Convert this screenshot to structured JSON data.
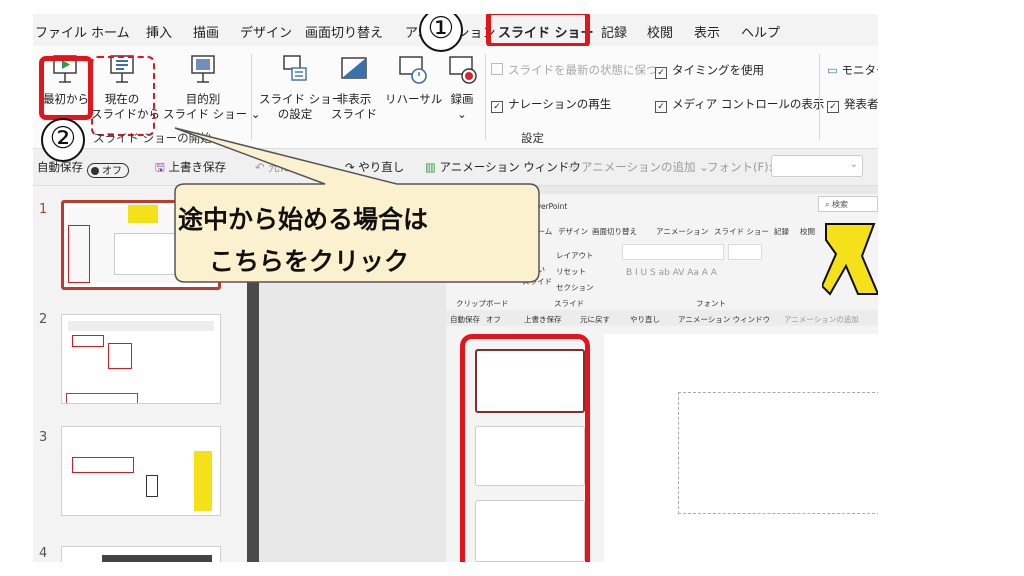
{
  "menu": {
    "items": [
      "ファイル",
      "ホーム",
      "挿入",
      "描画",
      "デザイン",
      "画面切り替え",
      "アニメーション",
      "スライド ショー",
      "記録",
      "校閲",
      "表示",
      "ヘルプ"
    ],
    "active": "スライド ショー"
  },
  "badges": {
    "one": "①",
    "two": "②"
  },
  "ribbon": {
    "from_beginning_label": "最初から",
    "from_current_line1": "現在の",
    "from_current_line2": "スライドから",
    "custom_show_line1": "目的別",
    "custom_show_line2": "スライド ショー ⌄",
    "setup_show_line1": "スライド ショー",
    "setup_show_line2": "の設定",
    "hide_slide_line1": "非表示",
    "hide_slide_line2": "スライド",
    "rehearse_label": "リハーサル",
    "record_line1": "録画",
    "record_line2": "⌄",
    "keep_updated_label": "スライドを最新の状態に保つ",
    "use_timings_label": "タイミングを使用",
    "play_narration_label": "ナレーションの再生",
    "show_media_controls_label": "メディア コントロールの表示",
    "monitor_label": "モニター:",
    "presenter_label": "発表者",
    "group_start_label": "スライド ショーの開始",
    "group_setup_label": "設定"
  },
  "qat": {
    "autosave_label": "自動保存",
    "autosave_state": "オフ",
    "save_label": "上書き保存",
    "undo_label": "元に戻す",
    "redo_label": "やり直し",
    "animation_window_label": "アニメーション ウィンドウ",
    "add_animation_label": "アニメーションの追加",
    "font_label": "フォント(F):"
  },
  "callout": {
    "line1": "途中から始める場合は",
    "line2": "こちらをクリック"
  },
  "thumbnails": [
    {
      "number": "1",
      "selected": true
    },
    {
      "number": "2",
      "selected": false
    },
    {
      "number": "3",
      "selected": false
    },
    {
      "number": "4",
      "selected": false
    }
  ],
  "inner": {
    "app_title": "PowerPoint",
    "search_label": "検索",
    "tabs": [
      "ホーム",
      "デザイン",
      "画面切り替え",
      "アニメーション",
      "スライド ショー",
      "記録",
      "校閲"
    ],
    "layout_label": "レイアウト",
    "reset_label": "リセット",
    "section_label": "セクション",
    "new_slide_label": "しい",
    "new_slide_label2": "スライド",
    "clipboard_label": "クリップボード",
    "slide_group_label": "スライド",
    "font_group_label": "フォント",
    "autosave_label": "自動保存",
    "autosave_state": "オフ",
    "save_label": "上書き保存",
    "undo_label": "元に戻す",
    "redo_label": "やり直し",
    "animation_window_label": "アニメーション ウィンドウ",
    "add_animation_label": "アニメーションの追加"
  },
  "colors": {
    "highlight": "#e4141b",
    "selected": "#c0392b",
    "accent_yellow": "#f5e11a",
    "callout_fill": "#fbf1cf"
  }
}
